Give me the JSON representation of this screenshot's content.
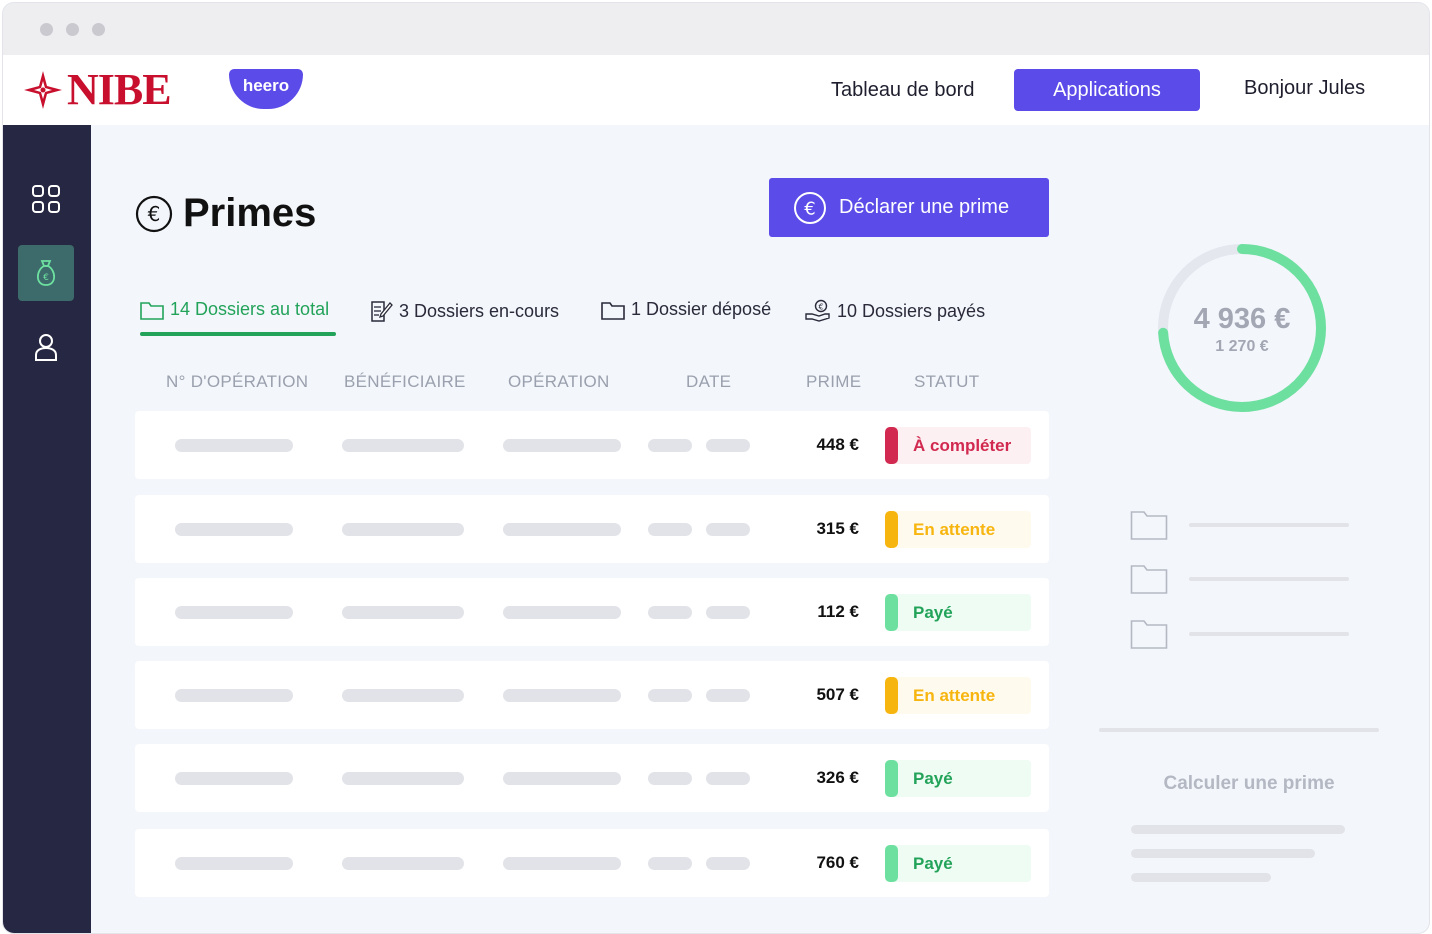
{
  "header": {
    "brand": "NIBE",
    "sub_brand": "heero",
    "nav": {
      "dashboard": "Tableau de bord",
      "applications": "Applications",
      "greeting": "Bonjour Jules"
    }
  },
  "sidebar": {
    "items": [
      {
        "icon": "grid-icon"
      },
      {
        "icon": "money-bag-euro-icon",
        "active": true
      },
      {
        "icon": "user-icon"
      }
    ]
  },
  "page": {
    "title": "Primes",
    "declare_button": "Déclarer une prime"
  },
  "tabs": [
    {
      "label": "14 Dossiers au total",
      "icon": "folder-icon",
      "active": true
    },
    {
      "label": "3 Dossiers en-cours",
      "icon": "document-edit-icon"
    },
    {
      "label": "1 Dossier déposé",
      "icon": "folder-icon"
    },
    {
      "label": "10 Dossiers payés",
      "icon": "hand-coin-icon"
    }
  ],
  "table": {
    "columns": [
      "N° D'OPÉRATION",
      "BÉNÉFICIAIRE",
      "OPÉRATION",
      "DATE",
      "PRIME",
      "STATUT"
    ],
    "rows": [
      {
        "prime": "448 €",
        "status": "À compléter",
        "status_kind": "incomplete"
      },
      {
        "prime": "315 €",
        "status": "En attente",
        "status_kind": "pending"
      },
      {
        "prime": "112 €",
        "status": "Payé",
        "status_kind": "paid"
      },
      {
        "prime": "507 €",
        "status": "En attente",
        "status_kind": "pending"
      },
      {
        "prime": "326 €",
        "status": "Payé",
        "status_kind": "paid"
      },
      {
        "prime": "760 €",
        "status": "Payé",
        "status_kind": "paid"
      }
    ]
  },
  "summary": {
    "total": "4 936 €",
    "secondary": "1 270 €",
    "progress_fraction": 0.74
  },
  "calculator": {
    "title": "Calculer une prime"
  },
  "colors": {
    "accent": "#5b4be8",
    "brand_red": "#c8102e",
    "sidebar": "#262843",
    "green": "#23a35a",
    "incomplete": "#d1294f",
    "pending": "#f7b50f",
    "paid": "#6de0a0"
  }
}
